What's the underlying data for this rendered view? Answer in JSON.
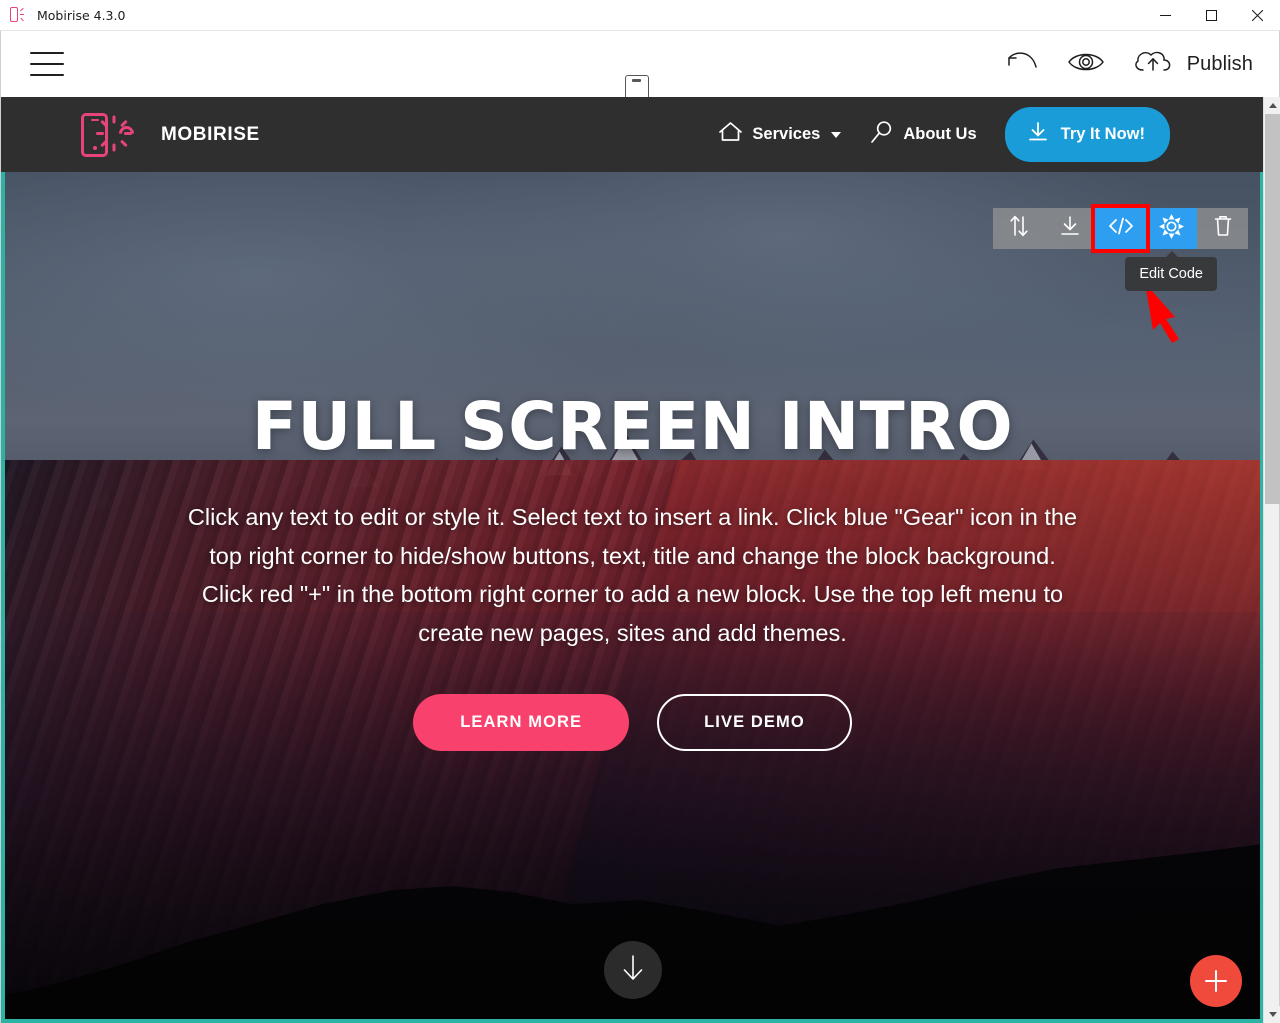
{
  "window": {
    "title": "Mobirise 4.3.0",
    "app_icon": "mobirise-phone-icon",
    "minimize_label": "–",
    "maximize_label": "□",
    "close_label": "✕"
  },
  "app_toolbar": {
    "menu_icon": "hamburger-menu-icon",
    "device_toggle_icon": "mobile-device-icon",
    "undo_icon": "undo-arrow-icon",
    "preview_icon": "eye-preview-icon",
    "publish_icon": "cloud-upload-icon",
    "publish_label": "Publish"
  },
  "site_nav": {
    "brand_name": "MOBIRISE",
    "brand_logo_icon": "mobirise-phone-sun-logo-icon",
    "links": [
      {
        "label": "Services",
        "icon": "home-icon",
        "has_dropdown": true
      },
      {
        "label": "About Us",
        "icon": "magnifier-icon",
        "has_dropdown": false
      }
    ],
    "cta": {
      "label": "Try It Now!",
      "icon": "download-icon"
    }
  },
  "hero": {
    "title": "FULL SCREEN INTRO",
    "text": "Click any text to edit or style it. Select text to insert a link. Click blue \"Gear\" icon in the top right corner to hide/show buttons, text, title and change the block background. Click red \"+\" in the bottom right corner to add a new block. Use the top left menu to create new pages, sites and add themes.",
    "buttons": [
      {
        "label": "LEARN MORE",
        "style": "filled"
      },
      {
        "label": "LIVE DEMO",
        "style": "outline"
      }
    ],
    "scroll_down_icon": "arrow-down-icon",
    "background_description": "mountain-range-at-dusk-photo"
  },
  "block_toolbar": {
    "buttons": [
      {
        "name": "move-block",
        "icon": "up-down-arrows-icon",
        "state": "normal"
      },
      {
        "name": "save-block",
        "icon": "download-icon",
        "state": "normal"
      },
      {
        "name": "edit-code",
        "icon": "code-brackets-icon",
        "state": "active-highlighted"
      },
      {
        "name": "block-settings",
        "icon": "gear-icon",
        "state": "active"
      },
      {
        "name": "delete-block",
        "icon": "trash-icon",
        "state": "normal"
      }
    ],
    "tooltip": "Edit Code",
    "annotation_arrow_color": "#ff0000",
    "highlight_color": "#ff0000"
  },
  "add_block": {
    "icon": "plus-icon",
    "color": "#f04a3c"
  },
  "scrollbar": {
    "up_arrow_icon": "chevron-up-icon",
    "down_arrow_icon": "chevron-down-icon"
  },
  "colors": {
    "accent_pink": "#f8416c",
    "accent_blue": "#1a9cd8",
    "toolbar_blue": "#2e9ff0",
    "selection_teal": "#2db3a5",
    "nav_dark": "#2f2f2f",
    "highlight_red": "#ff0000",
    "add_block_red": "#f04a3c"
  }
}
